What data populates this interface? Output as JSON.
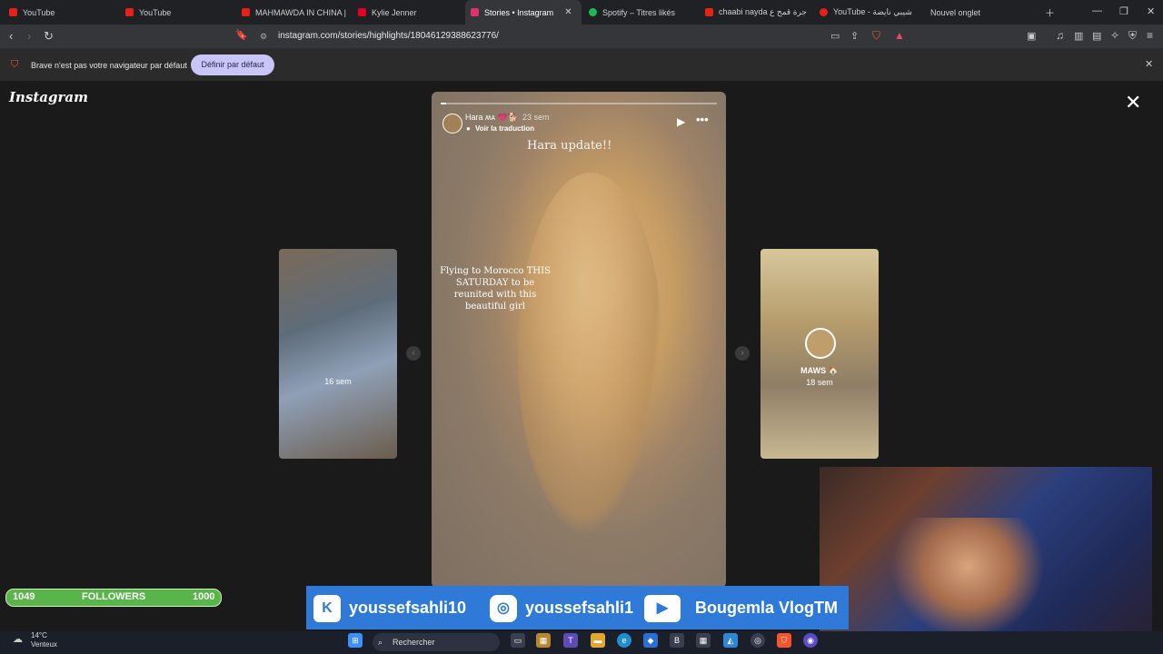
{
  "browser": {
    "tabs": [
      {
        "label": "YouTube",
        "color": "#e62117"
      },
      {
        "label": "YouTube",
        "color": "#e62117"
      },
      {
        "label": "MAHMAWDA IN CHINA |",
        "color": "#e62117"
      },
      {
        "label": "Kylie Jenner",
        "color": "#e60023"
      },
      {
        "label": "Stories • Instagram",
        "color": "#e1306c",
        "active": true
      },
      {
        "label": "Spotify – Titres likés",
        "color": "#1db954"
      },
      {
        "label": "chaabi nayda جرة قمح ع",
        "color": "#e62117"
      },
      {
        "label": "YouTube - شيبي نايضة",
        "color": "#e62117"
      },
      {
        "label": "Nouvel onglet",
        "color": "#888888"
      }
    ],
    "url": "instagram.com/stories/highlights/18046129388623776/",
    "infobar_text": "Brave n'est pas votre navigateur par défaut",
    "infobar_button": "Définir par défaut"
  },
  "instagram": {
    "logo": "Instagram",
    "story": {
      "username": "Hara ʍᴀ 💗🐕",
      "time": "23 sem",
      "translate": "Voir la traduction",
      "headline": "Hara update!!",
      "caption": "Flying to Morocco THIS SATURDAY to be reunited with this beautiful girl",
      "progress": 0.02
    },
    "prev_story": {
      "time": "16 sem"
    },
    "next_story": {
      "name": "MAWS 🏠",
      "time": "18 sem"
    }
  },
  "overlay": {
    "followers_label": "FOLLOWERS",
    "followers_current": "1049",
    "followers_goal": "1000",
    "socials": [
      "youssefsahli10",
      "youssefsahli1",
      "Bougemla VlogTM"
    ]
  },
  "taskbar": {
    "temp": "14°C",
    "weather": "Venteux",
    "search": "Rechercher"
  }
}
